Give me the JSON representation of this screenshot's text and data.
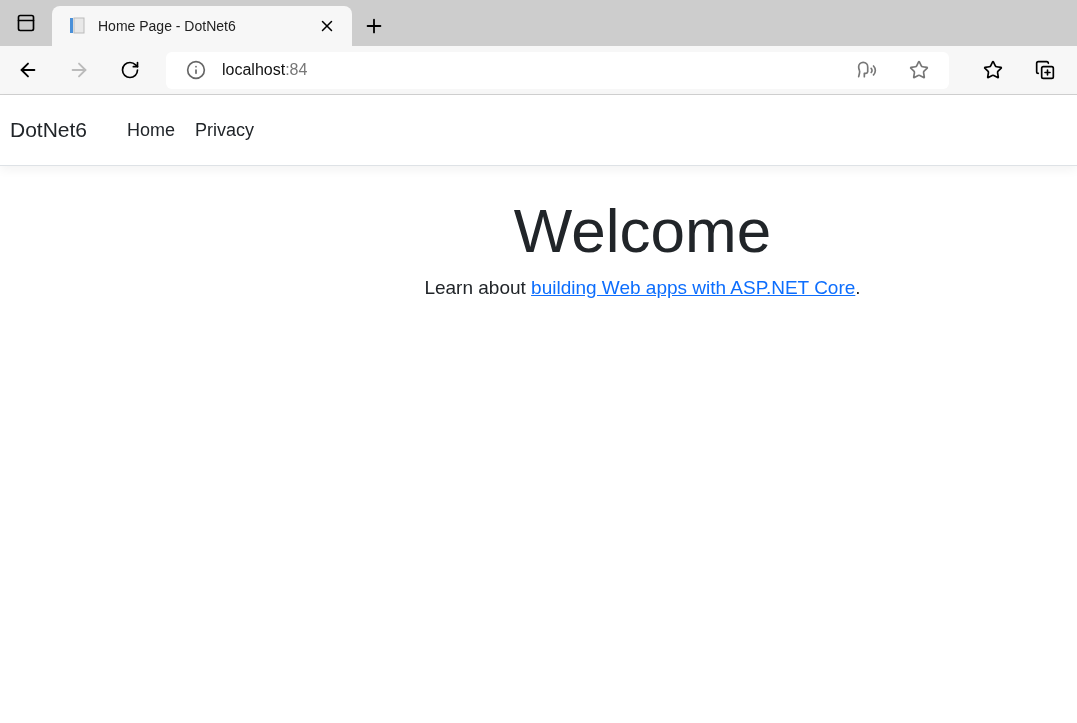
{
  "browser": {
    "tab": {
      "title": "Home Page - DotNet6",
      "selected": true
    },
    "address": {
      "host": "localhost",
      "port": ":84"
    },
    "forward_disabled": true
  },
  "navbar": {
    "brand": "DotNet6",
    "links": [
      {
        "label": "Home"
      },
      {
        "label": "Privacy"
      }
    ]
  },
  "main": {
    "heading": "Welcome",
    "text_before": "Learn about ",
    "link": "building Web apps with ASP.NET Core",
    "text_after": "."
  }
}
